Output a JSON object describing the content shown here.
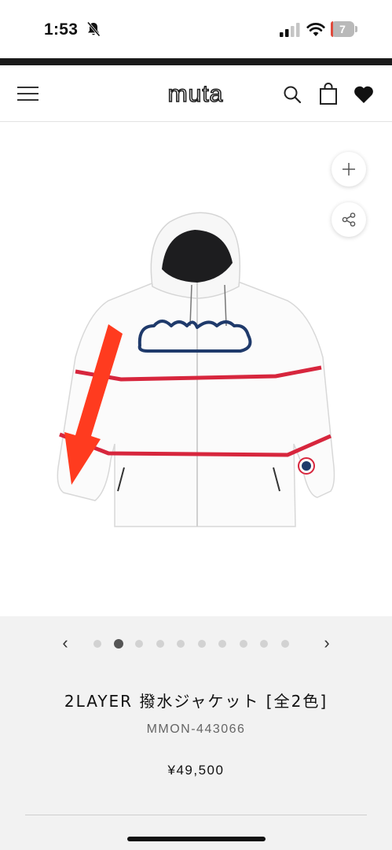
{
  "status_bar": {
    "time": "1:53",
    "battery_level": "7",
    "icons": [
      "bell-slash-icon",
      "cellular-signal-icon",
      "wifi-icon",
      "battery-icon"
    ]
  },
  "header": {
    "logo_text": "muta",
    "icons": [
      "hamburger-menu-icon",
      "search-icon",
      "shopping-bag-icon",
      "heart-icon"
    ]
  },
  "gallery": {
    "buttons": [
      "plus-icon",
      "share-icon"
    ],
    "prev_label": "‹",
    "next_label": "›",
    "total_dots": 10,
    "active_index": 1
  },
  "product": {
    "title": "2LAYER 撥水ジャケット [全2色]",
    "sku": "MMON-443066",
    "price": "¥49,500"
  },
  "colors": {
    "jacket": "#ffffff",
    "stripe": "#d7263d",
    "arrow": "#ff3b1f",
    "logo_outline": "#1f3a6b",
    "info_bg": "#f2f2f2"
  }
}
